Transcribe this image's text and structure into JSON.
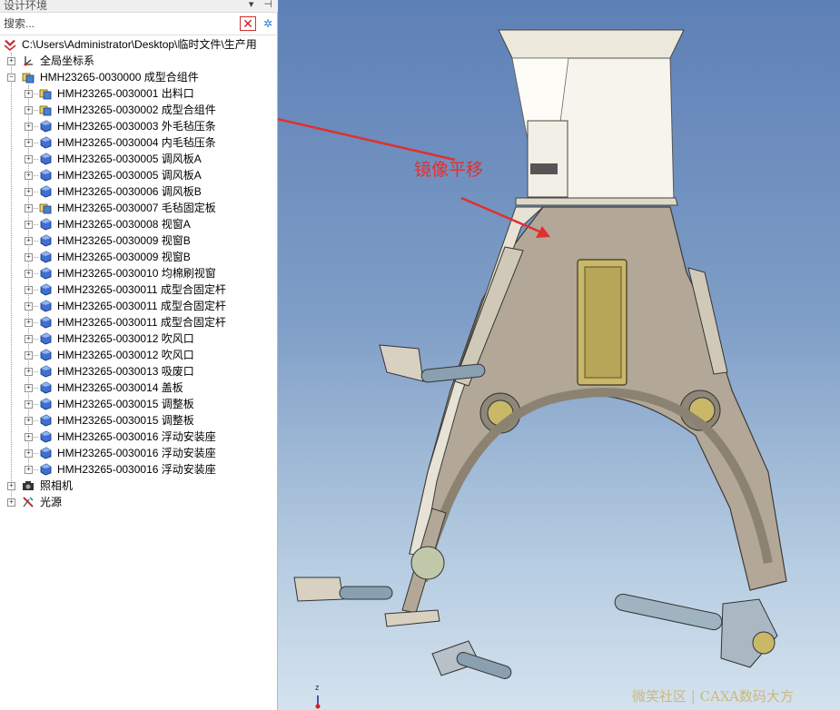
{
  "panel": {
    "title": "设计环境",
    "pin_icon": "pin-icon",
    "menu_icon": "dropdown-arrow-icon"
  },
  "search": {
    "placeholder": "搜索..."
  },
  "tree": {
    "root": {
      "label": "C:\\Users\\Administrator\\Desktop\\临时文件\\生产用"
    },
    "coords": {
      "label": "全局坐标系"
    },
    "assembly": {
      "label": "HMH23265-0030000 成型合组件"
    },
    "children": [
      {
        "label": "HMH23265-0030001 出料口",
        "icon": "assembly"
      },
      {
        "label": "HMH23265-0030002 成型合组件",
        "icon": "assembly"
      },
      {
        "label": "HMH23265-0030003 外毛毡压条",
        "icon": "part"
      },
      {
        "label": "HMH23265-0030004 内毛毡压条",
        "icon": "part"
      },
      {
        "label": "HMH23265-0030005 调风板A",
        "icon": "part"
      },
      {
        "label": "HMH23265-0030005 调风板A",
        "icon": "part"
      },
      {
        "label": "HMH23265-0030006 调风板B",
        "icon": "part"
      },
      {
        "label": "HMH23265-0030007 毛毡固定板",
        "icon": "assembly"
      },
      {
        "label": "HMH23265-0030008 视窗A",
        "icon": "part"
      },
      {
        "label": "HMH23265-0030009 视窗B",
        "icon": "part"
      },
      {
        "label": "HMH23265-0030009 视窗B",
        "icon": "part"
      },
      {
        "label": "HMH23265-0030010 均棉刷视窗",
        "icon": "part"
      },
      {
        "label": "HMH23265-0030011 成型合固定杆",
        "icon": "part"
      },
      {
        "label": "HMH23265-0030011 成型合固定杆",
        "icon": "part"
      },
      {
        "label": "HMH23265-0030011 成型合固定杆",
        "icon": "part"
      },
      {
        "label": "HMH23265-0030012 吹风口",
        "icon": "part"
      },
      {
        "label": "HMH23265-0030012 吹风口",
        "icon": "part"
      },
      {
        "label": "HMH23265-0030013 吸废口",
        "icon": "part"
      },
      {
        "label": "HMH23265-0030014 盖板",
        "icon": "part"
      },
      {
        "label": "HMH23265-0030015 调整板",
        "icon": "part"
      },
      {
        "label": "HMH23265-0030015 调整板",
        "icon": "part"
      },
      {
        "label": "HMH23265-0030016 浮动安装座",
        "icon": "part"
      },
      {
        "label": "HMH23265-0030016 浮动安装座",
        "icon": "part"
      },
      {
        "label": "HMH23265-0030016 浮动安装座",
        "icon": "part"
      }
    ],
    "camera": {
      "label": "照相机"
    },
    "light": {
      "label": "光源"
    }
  },
  "viewport": {
    "annotation": "镜像平移",
    "watermark": "微笑社区 | CAXA数码大方",
    "axis_label": "z",
    "colors": {
      "arrow": "#e03030",
      "body": "#b5aa9c",
      "hopper": "#f4f1e8",
      "brass": "#c8b868",
      "shaft": "#8aa0b0"
    }
  }
}
